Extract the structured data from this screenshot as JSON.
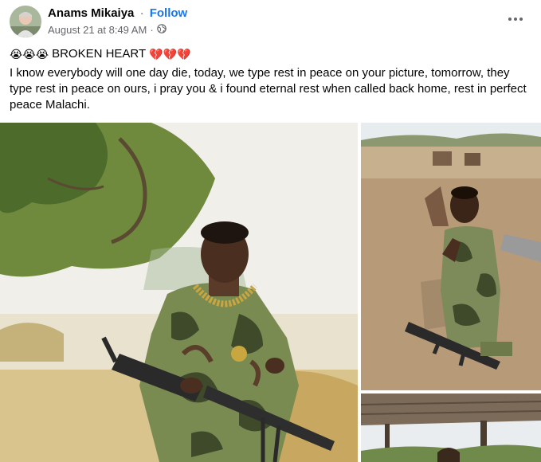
{
  "post": {
    "author": "Anams Mikaiya",
    "separator": "·",
    "follow_label": "Follow",
    "timestamp": "August 21 at 8:49 AM",
    "meta_separator": "·",
    "privacy_icon": "globe-icon",
    "more_icon": "more-options-icon",
    "title_emoji": "😭😭😭",
    "title_text": "BROKEN HEART",
    "title_hearts": "💔💔💔",
    "body": "I know everybody will one day die, today, we type rest in peace on your picture, tomorrow, they type rest in peace on ours, i pray you & i found eternal rest when called back home, rest in perfect peace Malachi."
  },
  "photos": [
    {
      "alt": "photo-soldier-with-machine-gun"
    },
    {
      "alt": "photo-soldier-kneeling-praying"
    },
    {
      "alt": "photo-shelter-roof"
    }
  ],
  "colors": {
    "link": "#1877f2",
    "secondary_text": "#65676b",
    "primary_text": "#050505"
  }
}
